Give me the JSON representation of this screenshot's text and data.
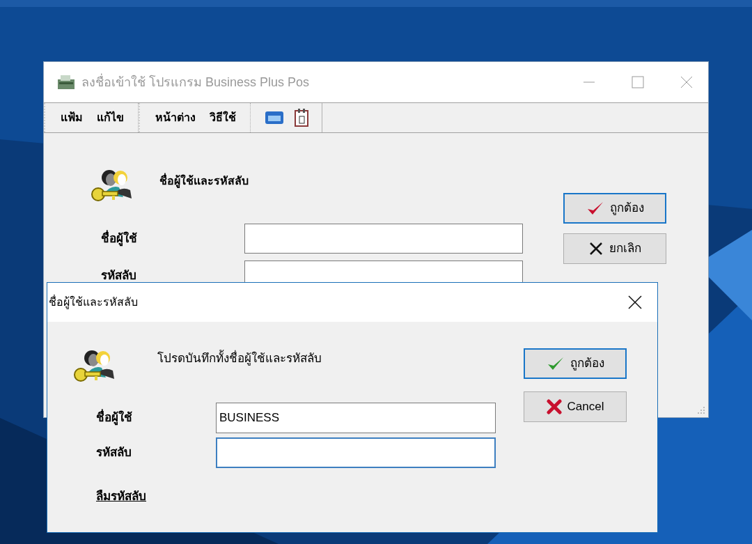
{
  "main_window": {
    "title": "ลงชื่อเข้าใช้ โปรแกรม Business Plus Pos",
    "active": false,
    "menu_groups": [
      [
        "แฟ้ม",
        "แก้ไข"
      ],
      [
        "หน้าต่าง",
        "วิธีใช้"
      ]
    ],
    "heading": "ชื่อผู้ใช้และรหัสลับ",
    "fields": [
      {
        "label": "ชื่อผู้ใช้"
      },
      {
        "label": "รหัสลับ"
      }
    ],
    "buttons": [
      {
        "label": "ถูกต้อง",
        "kind": "ok",
        "default": true
      },
      {
        "label": "ยกเลิก",
        "kind": "cancel",
        "default": false
      }
    ]
  },
  "dialog": {
    "title": "ชื่อผู้ใช้และรหัสลับ",
    "active": true,
    "message": "โปรดบันทึกทั้งชื่อผู้ใช้และรหัสลับ",
    "fields": [
      {
        "label": "ชื่อผู้ใช้",
        "value": "BUSINESS",
        "focused": false
      },
      {
        "label": "รหัสลับ",
        "focused": true
      }
    ],
    "link": "ลืมรหัสลับ",
    "buttons": [
      {
        "label": "ถูกต้อง",
        "kind": "ok",
        "default": true
      },
      {
        "label": "Cancel",
        "kind": "cancel",
        "default": false
      }
    ]
  }
}
